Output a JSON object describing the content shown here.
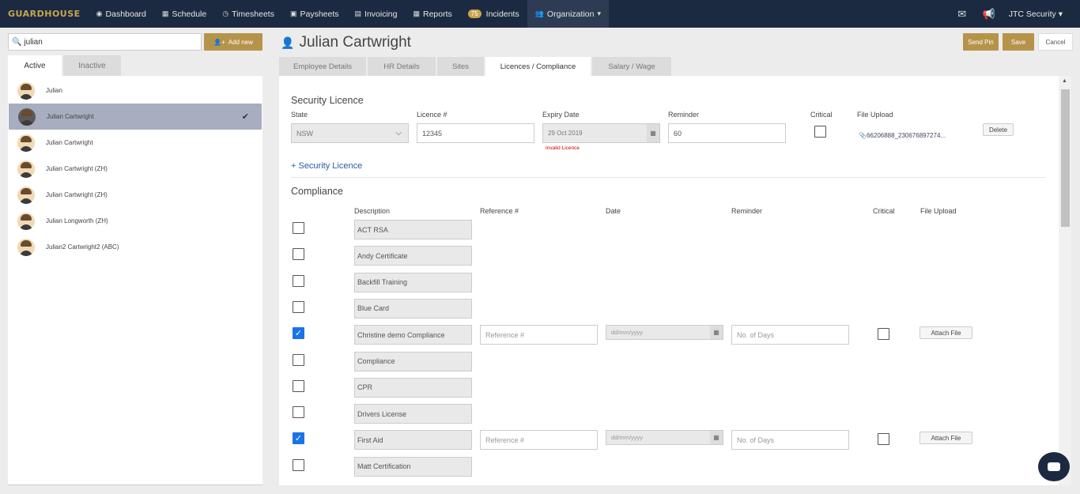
{
  "nav": {
    "brand": "GUARDHOUSE",
    "items": [
      {
        "label": "Dashboard",
        "icon": "dashboard-icon"
      },
      {
        "label": "Schedule",
        "icon": "calendar-icon"
      },
      {
        "label": "Timesheets",
        "icon": "clock-icon"
      },
      {
        "label": "Paysheets",
        "icon": "money-icon"
      },
      {
        "label": "Invoicing",
        "icon": "invoice-icon"
      },
      {
        "label": "Reports",
        "icon": "table-icon"
      },
      {
        "label": "Incidents",
        "icon": "incident-icon",
        "badge": "75"
      },
      {
        "label": "Organization",
        "icon": "users-icon"
      }
    ],
    "company": "JTC Security"
  },
  "left": {
    "search_value": "julian",
    "add_new": "Add new",
    "tabs": [
      "Active",
      "Inactive"
    ],
    "people": [
      "Julian",
      "Julian Cartwright",
      "Julian Cartwright",
      "Julian Cartwright (ZH)",
      "Julian Cartwright (ZH)",
      "Julian Longworth (ZH)",
      "Julian2 Cartwright2 (ABC)"
    ]
  },
  "header": {
    "title": "Julian Cartwright",
    "send_pin": "Send Pin",
    "save": "Save",
    "cancel": "Cancel"
  },
  "tabs": [
    "Employee Details",
    "HR Details",
    "Sites",
    "Licences / Compliance",
    "Salary / Wage"
  ],
  "licence": {
    "title": "Security Licence",
    "labels": [
      "State",
      "Licence #",
      "Expiry Date",
      "Reminder",
      "Critical",
      "File Upload"
    ],
    "state": "NSW",
    "number": "12345",
    "expiry": "29 Oct 2019",
    "reminder": "60",
    "invalid": "Invalid Licence",
    "file": "66206888_230676897274...",
    "delete": "Delete",
    "add_link": "+ Security Licence"
  },
  "compliance": {
    "title": "Compliance",
    "headers": [
      "Description",
      "Reference #",
      "Date",
      "Reminder",
      "Critical",
      "File Upload"
    ],
    "ref_placeholder": "Reference #",
    "date_placeholder": "dd/mm/yyyy",
    "reminder_placeholder": "No. of Days",
    "attach": "Attach File",
    "items": [
      {
        "label": "ACT RSA",
        "checked": false
      },
      {
        "label": "Andy Certificate",
        "checked": false
      },
      {
        "label": "Backfill Training",
        "checked": false
      },
      {
        "label": "Blue Card",
        "checked": false
      },
      {
        "label": "Christine demo Compliance",
        "checked": true
      },
      {
        "label": "Compliance",
        "checked": false
      },
      {
        "label": "CPR",
        "checked": false
      },
      {
        "label": "Drivers License",
        "checked": false
      },
      {
        "label": "First Aid",
        "checked": true
      },
      {
        "label": "Matt Certification",
        "checked": false
      }
    ]
  }
}
